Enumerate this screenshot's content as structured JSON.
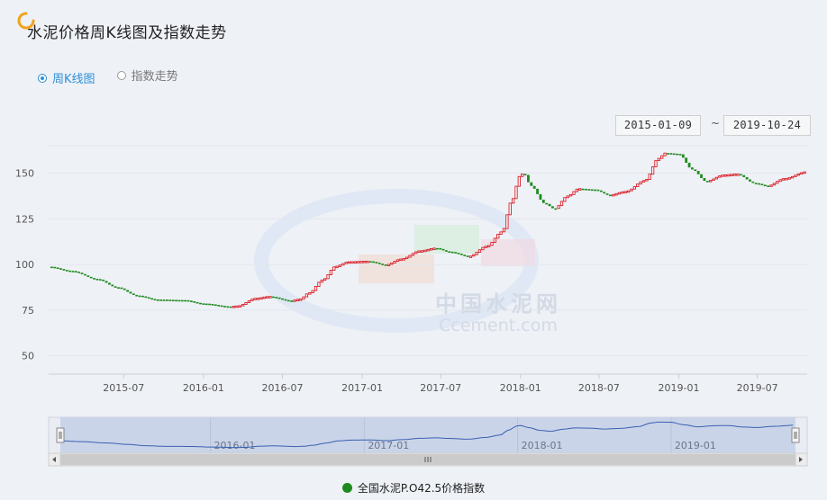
{
  "header": {
    "title": "水泥价格周K线图及指数走势"
  },
  "view_toggle": {
    "options": [
      {
        "label": "周K线图",
        "selected": true
      },
      {
        "label": "指数走势",
        "selected": false
      }
    ]
  },
  "date_range": {
    "start": "2015-01-09",
    "separator": "~",
    "end": "2019-10-24"
  },
  "colors": {
    "up": "#d81e2a",
    "down": "#1e8a1e",
    "accent": "#2f8fd8",
    "navigator_line": "#3a5fb0"
  },
  "watermark": {
    "cn": "中国水泥网",
    "en": "Ccement.com"
  },
  "chart_data": {
    "type": "candlestick",
    "title": "",
    "xlabel": "",
    "ylabel": "",
    "x_range": [
      "2015-01-09",
      "2019-10-24"
    ],
    "ylim": [
      40,
      165
    ],
    "y_ticks": [
      50,
      75,
      100,
      125,
      150
    ],
    "x_ticks": [
      "2015-07",
      "2016-01",
      "2016-07",
      "2017-01",
      "2017-07",
      "2018-01",
      "2018-07",
      "2019-01",
      "2019-07"
    ],
    "grid": true,
    "legend_position": "bottom",
    "series": [
      {
        "name": "全国水泥P.O42.5价格指数",
        "weekly_close_points": [
          [
            "2015-01-09",
            98.8
          ],
          [
            "2015-03-01",
            96.5
          ],
          [
            "2015-05-01",
            92.0
          ],
          [
            "2015-06-15",
            87.5
          ],
          [
            "2015-08-01",
            83.0
          ],
          [
            "2015-09-15",
            80.8
          ],
          [
            "2015-11-15",
            80.5
          ],
          [
            "2016-01-01",
            78.6
          ],
          [
            "2016-03-01",
            77.0
          ],
          [
            "2016-03-20",
            77.3
          ],
          [
            "2016-05-01",
            81.5
          ],
          [
            "2016-06-01",
            82.5
          ],
          [
            "2016-07-20",
            80.2
          ],
          [
            "2016-08-10",
            81.0
          ],
          [
            "2016-09-01",
            84.5
          ],
          [
            "2016-10-01",
            91.5
          ],
          [
            "2016-11-01",
            99.0
          ],
          [
            "2016-12-01",
            101.5
          ],
          [
            "2017-01-15",
            101.8
          ],
          [
            "2017-02-25",
            99.8
          ],
          [
            "2017-04-01",
            103.0
          ],
          [
            "2017-05-15",
            107.5
          ],
          [
            "2017-06-20",
            109.0
          ],
          [
            "2017-07-20",
            107.0
          ],
          [
            "2017-09-05",
            104.5
          ],
          [
            "2017-10-15",
            110.0
          ],
          [
            "2017-11-20",
            118.0
          ],
          [
            "2017-12-10",
            134.0
          ],
          [
            "2017-12-31",
            148.5
          ],
          [
            "2018-01-08",
            150.0
          ],
          [
            "2018-01-25",
            143.0
          ],
          [
            "2018-02-25",
            133.5
          ],
          [
            "2018-03-20",
            130.5
          ],
          [
            "2018-04-20",
            137.5
          ],
          [
            "2018-05-15",
            141.5
          ],
          [
            "2018-06-20",
            141.0
          ],
          [
            "2018-07-25",
            138.0
          ],
          [
            "2018-09-01",
            140.0
          ],
          [
            "2018-10-15",
            146.0
          ],
          [
            "2018-11-15",
            158.0
          ],
          [
            "2018-12-01",
            161.0
          ],
          [
            "2019-01-01",
            160.5
          ],
          [
            "2019-02-01",
            152.0
          ],
          [
            "2019-03-05",
            145.5
          ],
          [
            "2019-04-15",
            149.0
          ],
          [
            "2019-05-15",
            149.5
          ],
          [
            "2019-06-25",
            144.5
          ],
          [
            "2019-07-25",
            143.0
          ],
          [
            "2019-09-01",
            147.0
          ],
          [
            "2019-10-24",
            150.8
          ]
        ]
      }
    ],
    "navigator": {
      "x_ticks": [
        "2016-01",
        "2017-01",
        "2018-01",
        "2019-01"
      ]
    }
  }
}
